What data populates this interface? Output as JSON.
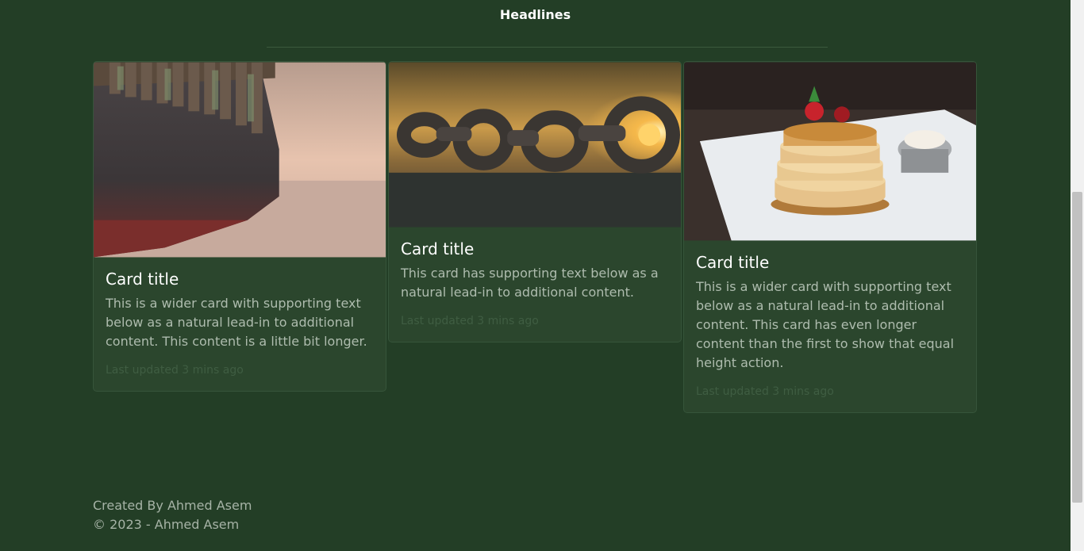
{
  "header": {
    "title": "Headlines"
  },
  "cards": [
    {
      "title": "Card title",
      "text": "This is a wider card with supporting text below as a natural lead-in to additional content. This content is a little bit longer.",
      "updated": "Last updated 3 mins ago",
      "image": "ship-photo"
    },
    {
      "title": "Card title",
      "text": "This card has supporting text below as a natural lead-in to additional content.",
      "updated": "Last updated 3 mins ago",
      "image": "chain-photo"
    },
    {
      "title": "Card title",
      "text": "This is a wider card with supporting text below as a natural lead-in to additional content. This card has even longer content than the first to show that equal height action.",
      "updated": "Last updated 3 mins ago",
      "image": "pancakes-photo"
    }
  ],
  "footer": {
    "created_by": "Created By Ahmed Asem",
    "copyright": "© 2023 - Ahmed Asem"
  },
  "colors": {
    "background": "#233e26",
    "card": "#2b462d",
    "text_muted": "#aebcae"
  }
}
